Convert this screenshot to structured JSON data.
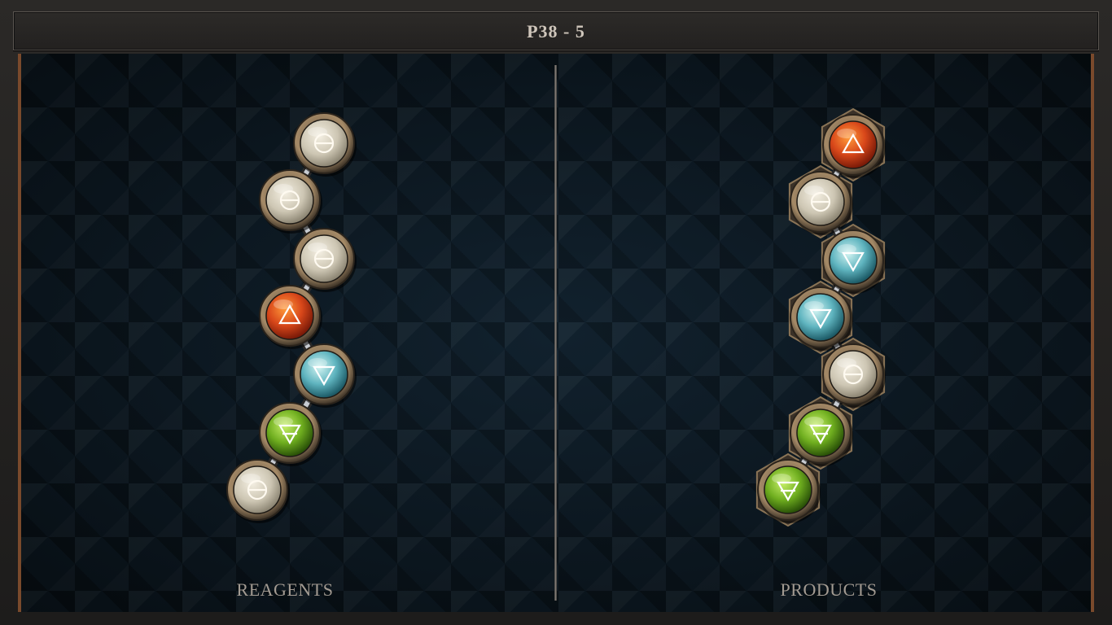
{
  "header": {
    "title": "P38 - 5"
  },
  "panels": {
    "reagents": {
      "label": "REAGENTS",
      "atoms": [
        {
          "element": "salt",
          "glyph": "⊖"
        },
        {
          "element": "salt",
          "glyph": "⊖"
        },
        {
          "element": "salt",
          "glyph": "⊖"
        },
        {
          "element": "fire",
          "glyph": "△"
        },
        {
          "element": "water",
          "glyph": "▽"
        },
        {
          "element": "earth",
          "glyph": "🜃"
        },
        {
          "element": "salt",
          "glyph": "⊖"
        }
      ]
    },
    "products": {
      "label": "PRODUCTS",
      "atoms": [
        {
          "element": "fire",
          "glyph": "△"
        },
        {
          "element": "salt",
          "glyph": "⊖"
        },
        {
          "element": "water",
          "glyph": "▽"
        },
        {
          "element": "water",
          "glyph": "▽"
        },
        {
          "element": "salt",
          "glyph": "⊖"
        },
        {
          "element": "earth",
          "glyph": "🜃"
        },
        {
          "element": "earth",
          "glyph": "🜃"
        }
      ]
    }
  },
  "colors": {
    "salt": "#d8d2c2",
    "fire": "#d8471a",
    "water": "#5fb4bf",
    "earth": "#6fae1f",
    "bronze": "#a58a67"
  }
}
